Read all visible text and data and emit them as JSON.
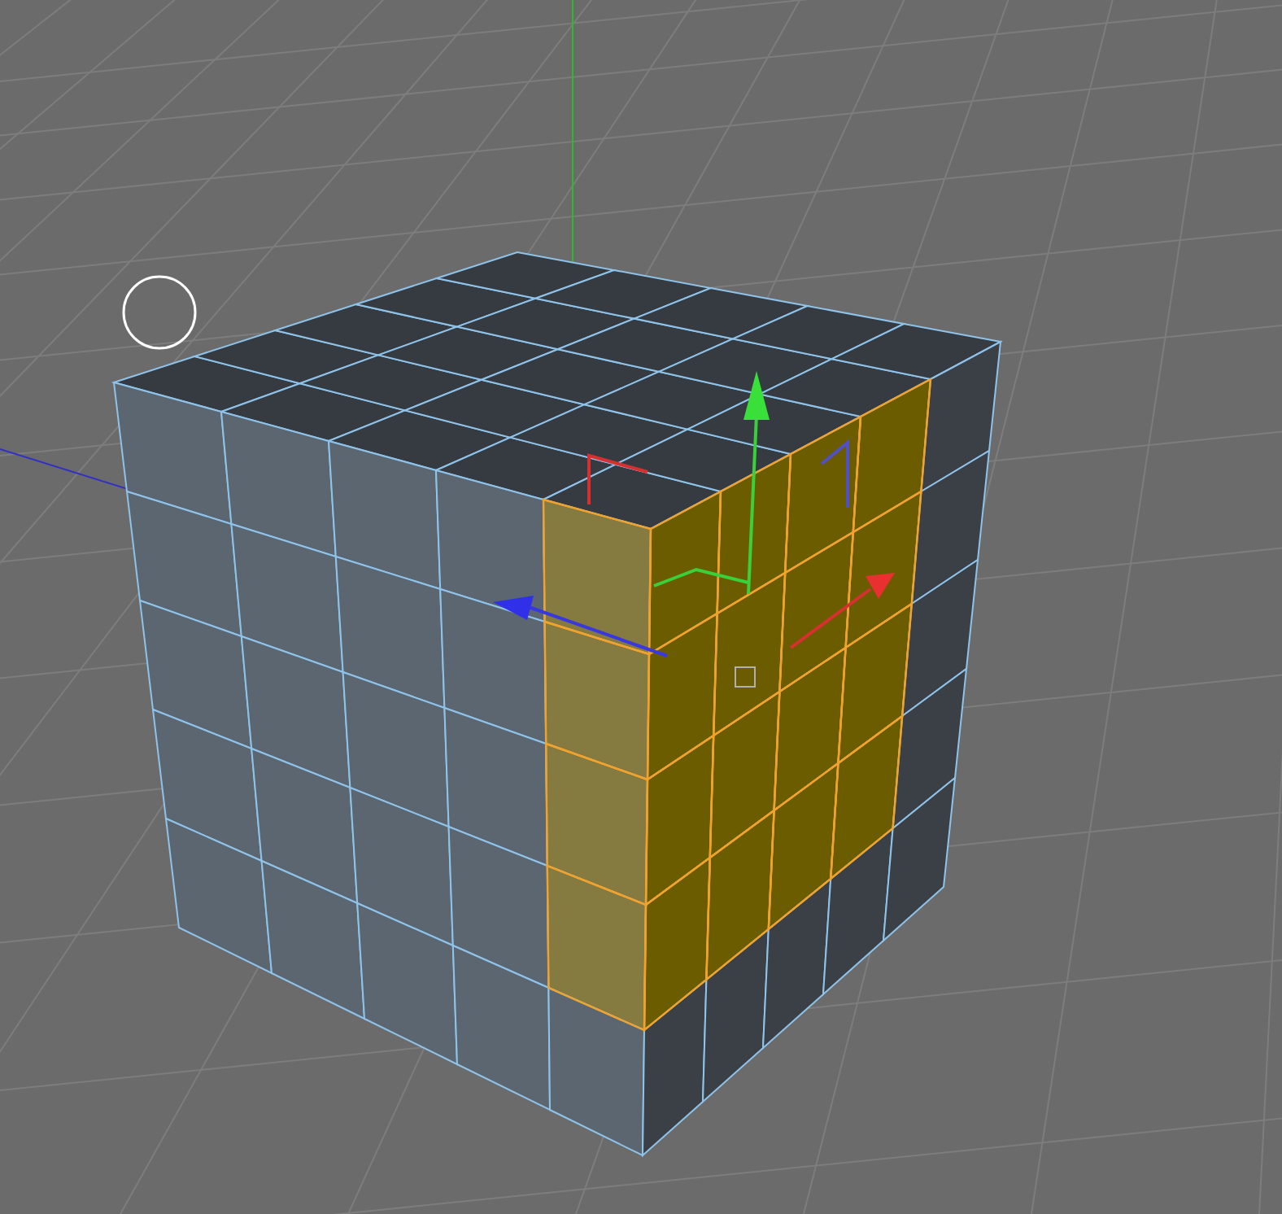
{
  "faces": [
    {
      "kind": "top",
      "cells": [
        {
          "selected": false
        },
        {
          "selected": false
        },
        {
          "selected": false
        },
        {
          "selected": false
        },
        {
          "selected": false
        },
        {
          "selected": false
        },
        {
          "selected": false
        },
        {
          "selected": false
        },
        {
          "selected": false
        },
        {
          "selected": false
        },
        {
          "selected": false
        },
        {
          "selected": false
        },
        {
          "selected": false
        },
        {
          "selected": false
        },
        {
          "selected": false
        },
        {
          "selected": false
        },
        {
          "selected": false
        },
        {
          "selected": false
        },
        {
          "selected": false
        },
        {
          "selected": false
        },
        {
          "selected": false
        },
        {
          "selected": false
        },
        {
          "selected": false
        },
        {
          "selected": false
        },
        {
          "selected": false
        }
      ]
    },
    {
      "kind": "front",
      "cells": [
        {
          "selected": false
        },
        {
          "selected": false
        },
        {
          "selected": false
        },
        {
          "selected": false
        },
        {
          "selected": true
        },
        {
          "selected": false
        },
        {
          "selected": false
        },
        {
          "selected": false
        },
        {
          "selected": false
        },
        {
          "selected": true
        },
        {
          "selected": false
        },
        {
          "selected": false
        },
        {
          "selected": false
        },
        {
          "selected": false
        },
        {
          "selected": true
        },
        {
          "selected": false
        },
        {
          "selected": false
        },
        {
          "selected": false
        },
        {
          "selected": false
        },
        {
          "selected": true
        },
        {
          "selected": false
        },
        {
          "selected": false
        },
        {
          "selected": false
        },
        {
          "selected": false
        },
        {
          "selected": false
        }
      ]
    },
    {
      "kind": "right",
      "cells": [
        {
          "selected": true
        },
        {
          "selected": true
        },
        {
          "selected": true
        },
        {
          "selected": true
        },
        {
          "selected": false
        },
        {
          "selected": true
        },
        {
          "selected": true
        },
        {
          "selected": true
        },
        {
          "selected": true
        },
        {
          "selected": false
        },
        {
          "selected": true
        },
        {
          "selected": true
        },
        {
          "selected": true
        },
        {
          "selected": true
        },
        {
          "selected": false
        },
        {
          "selected": true
        },
        {
          "selected": true
        },
        {
          "selected": true
        },
        {
          "selected": true
        },
        {
          "selected": false
        },
        {
          "selected": false
        },
        {
          "selected": false
        },
        {
          "selected": false
        },
        {
          "selected": false
        },
        {
          "selected": false
        }
      ]
    }
  ]
}
